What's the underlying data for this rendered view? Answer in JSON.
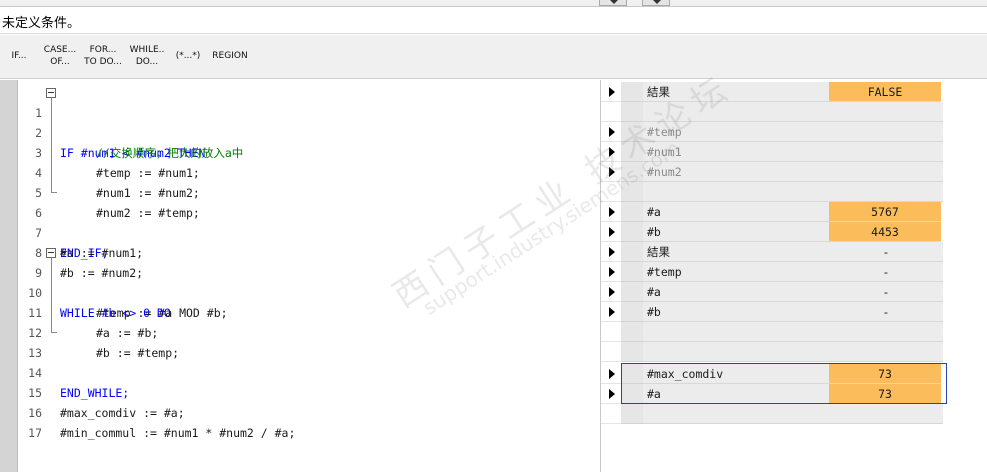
{
  "condition_bar": {
    "text": "未定义条件。"
  },
  "toolbar": {
    "buttons": [
      {
        "line1": "IF...",
        "line2": ""
      },
      {
        "line1": "CASE...",
        "line2": "OF..."
      },
      {
        "line1": "FOR...",
        "line2": "TO DO..."
      },
      {
        "line1": "WHILE..",
        "line2": "DO..."
      },
      {
        "line1": "(*...*)",
        "line2": ""
      },
      {
        "line1": "REGION",
        "line2": ""
      }
    ]
  },
  "editor": {
    "lines": [
      {
        "num": "1",
        "text": "IF #num1 < #num2 THEN"
      },
      {
        "num": "2",
        "text": "//交换顺序，把大的放入a中"
      },
      {
        "num": "3",
        "text": "#temp := #num1;"
      },
      {
        "num": "4",
        "text": "#num1 := #num2;"
      },
      {
        "num": "5",
        "text": "#num2 := #temp;"
      },
      {
        "num": "6",
        "text": "END_IF;"
      },
      {
        "num": "7",
        "text": "#a := #num1;"
      },
      {
        "num": "8",
        "text": "#b := #num2;"
      },
      {
        "num": "9",
        "text": "WHILE #b <> 0 DO"
      },
      {
        "num": "10",
        "text": "#temp := #a MOD #b;"
      },
      {
        "num": "11",
        "text": "#a := #b;"
      },
      {
        "num": "12",
        "text": "#b := #temp;"
      },
      {
        "num": "13",
        "text": "END_WHILE;"
      },
      {
        "num": "14",
        "text": ""
      },
      {
        "num": "15",
        "text": "#max_comdiv := #a;"
      },
      {
        "num": "16",
        "text": "#min_commul := #num1 * #num2 / #a;"
      },
      {
        "num": "17",
        "text": ""
      }
    ]
  },
  "monitor": {
    "rows": [
      {
        "name": "結果",
        "value": "FALSE",
        "arrow": true
      },
      {
        "name": "",
        "value": "",
        "arrow": false
      },
      {
        "name": "#temp",
        "value": "",
        "arrow": true
      },
      {
        "name": "#num1",
        "value": "",
        "arrow": true
      },
      {
        "name": "#num2",
        "value": "",
        "arrow": true
      },
      {
        "name": "",
        "value": "",
        "arrow": false
      },
      {
        "name": "#a",
        "value": "5767",
        "arrow": true
      },
      {
        "name": "#b",
        "value": "4453",
        "arrow": true
      },
      {
        "name": "結果",
        "value": "-",
        "arrow": true
      },
      {
        "name": "#temp",
        "value": "-",
        "arrow": true
      },
      {
        "name": "#a",
        "value": "-",
        "arrow": true
      },
      {
        "name": "#b",
        "value": "-",
        "arrow": true
      },
      {
        "name": "",
        "value": "",
        "arrow": false
      },
      {
        "name": "",
        "value": "",
        "arrow": false
      },
      {
        "name": "#max_comdiv",
        "value": "73",
        "arrow": true
      },
      {
        "name": "#a",
        "value": "73",
        "arrow": true
      },
      {
        "name": "",
        "value": "",
        "arrow": false
      }
    ]
  },
  "watermark": {
    "line1": "西门子工业 技术论坛",
    "line2": "support.industry.siemens.com"
  },
  "colors": {
    "keyword": "#0000ff",
    "comment": "#008000",
    "value_highlight": "#fbbd5c",
    "selection_border": "#2a3fb0"
  }
}
